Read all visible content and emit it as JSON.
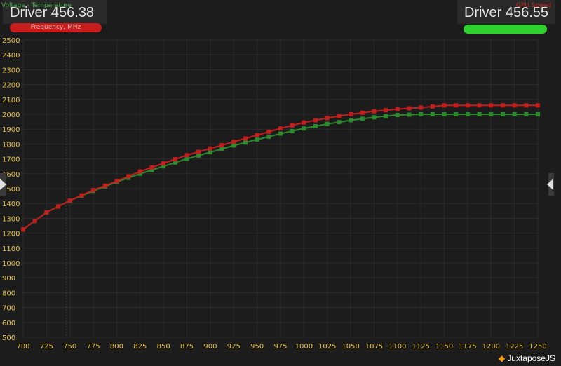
{
  "left_label": "Driver 456.38",
  "right_label": "Driver 456.55",
  "top_left_tag": "Voltage - Temperature",
  "top_right_tag": "GPU Speed",
  "freq_pill": "Frequency, MHz",
  "watermark": "JuxtaposeJS",
  "icons": {
    "left_handle": "chevron-right-icon",
    "right_handle": "chevron-left-icon",
    "watermark": "juxtapose-diamond-icon"
  },
  "colors": {
    "background": "#1c1c1c",
    "grid": "#2c2c2c",
    "tick_label": "#e6c24a",
    "series_red": "#c21e1e",
    "series_green": "#2d8a2d",
    "pill_red": "#c61c1c",
    "pill_green": "#2fd12f"
  },
  "chart_data": {
    "type": "line",
    "title": "",
    "xlabel": "",
    "ylabel": "",
    "xlim": [
      700,
      1250
    ],
    "ylim": [
      500,
      2500
    ],
    "x_ticks": [
      700,
      725,
      750,
      775,
      800,
      825,
      850,
      875,
      900,
      925,
      950,
      975,
      1000,
      1025,
      1050,
      1075,
      1100,
      1125,
      1150,
      1175,
      1200,
      1225,
      1250
    ],
    "y_ticks": [
      500,
      600,
      700,
      800,
      900,
      1000,
      1100,
      1200,
      1300,
      1400,
      1500,
      1600,
      1700,
      1800,
      1900,
      2000,
      2100,
      2200,
      2300,
      2400,
      2500
    ],
    "grid": true,
    "legend": "none",
    "x": [
      700,
      725,
      750,
      775,
      800,
      825,
      850,
      875,
      900,
      925,
      950,
      975,
      1000,
      1025,
      1050,
      1075,
      1100,
      1125,
      1150,
      1175,
      1200,
      1225,
      1250
    ],
    "series": [
      {
        "values": [
          1225,
          1340,
          1420,
          1490,
          1550,
          1615,
          1670,
          1725,
          1770,
          1815,
          1860,
          1905,
          1945,
          1975,
          2000,
          2020,
          2035,
          2045,
          2060,
          2060,
          2060,
          2060,
          2060
        ]
      },
      {
        "values": [
          1225,
          1340,
          1420,
          1485,
          1545,
          1600,
          1650,
          1700,
          1745,
          1790,
          1830,
          1870,
          1905,
          1935,
          1960,
          1980,
          1995,
          2000,
          2000,
          2000,
          2000,
          2000,
          2000
        ]
      }
    ]
  }
}
